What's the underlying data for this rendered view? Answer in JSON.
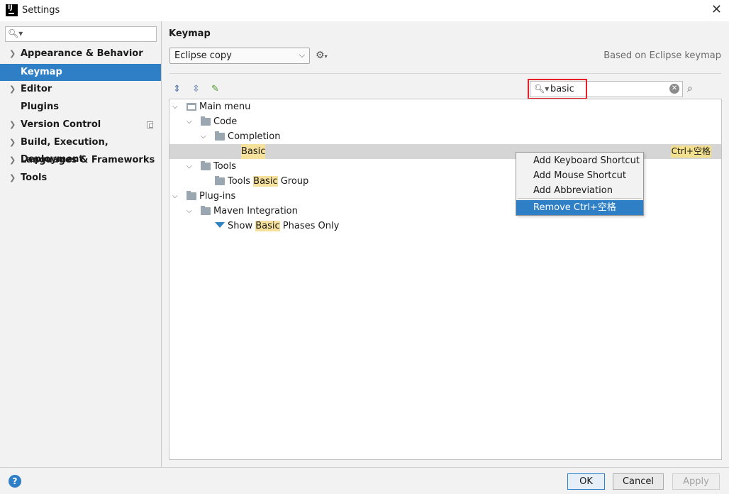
{
  "window": {
    "title": "Settings",
    "close_glyph": "✕"
  },
  "sidebar": {
    "search_placeholder": "",
    "items": [
      {
        "label": "Appearance & Behavior",
        "expandable": true
      },
      {
        "label": "Keymap",
        "selected": true
      },
      {
        "label": "Editor",
        "expandable": true
      },
      {
        "label": "Plugins"
      },
      {
        "label": "Version Control",
        "expandable": true
      },
      {
        "label": "Build, Execution, Deployment",
        "expandable": true
      },
      {
        "label": "Languages & Frameworks",
        "expandable": true
      },
      {
        "label": "Tools",
        "expandable": true
      }
    ]
  },
  "keymap": {
    "page_title": "Keymap",
    "selected_keymap": "Eclipse copy",
    "based_on": "Based on Eclipse keymap",
    "filter_value": "basic"
  },
  "tree": {
    "main_menu": "Main menu",
    "code": "Code",
    "completion": "Completion",
    "basic": "Basic",
    "basic_shortcut": "Ctrl+空格",
    "tools": "Tools",
    "tools_group_pre": "Tools ",
    "tools_group_hl": "Basic",
    "tools_group_post": " Group",
    "plugins": "Plug-ins",
    "maven": "Maven Integration",
    "show_pre": "Show ",
    "show_hl": "Basic",
    "show_post": " Phases Only"
  },
  "context_menu": {
    "add_keyboard": "Add Keyboard Shortcut",
    "add_mouse": "Add Mouse Shortcut",
    "add_abbrev": "Add Abbreviation",
    "remove": "Remove Ctrl+空格"
  },
  "footer": {
    "help": "?",
    "ok": "OK",
    "cancel": "Cancel",
    "apply": "Apply"
  },
  "colors": {
    "accent": "#2e7fc6",
    "search_highlight": "#f6e19c",
    "annotation_red": "#e8202a"
  }
}
